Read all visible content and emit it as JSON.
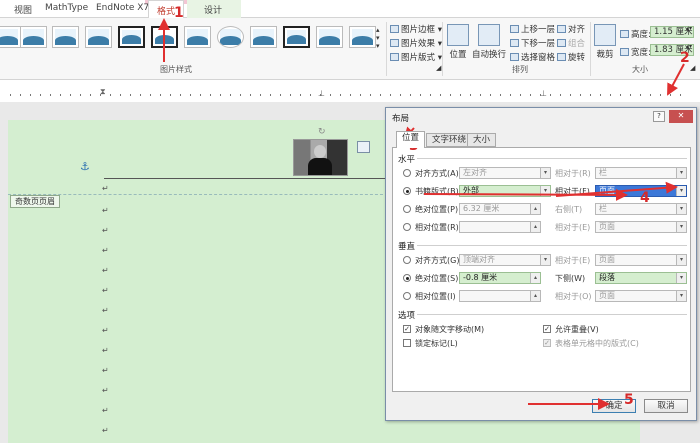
{
  "tabs": [
    "视图",
    "MathType",
    "EndNote X7",
    "格式",
    "设计"
  ],
  "ribbon": {
    "styles_group": "图片样式",
    "border": "图片边框",
    "effects": "图片效果",
    "layout": "图片版式",
    "position": "位置",
    "wrap": "自动换行",
    "bring_forward": "上移一层",
    "send_backward": "下移一层",
    "selection_pane": "选择窗格",
    "align": "对齐",
    "group": "组合",
    "rotate": "旋转",
    "arrange_group": "排列",
    "crop": "裁剪",
    "height_label": "高度:",
    "height_value": "1.15 厘米",
    "width_label": "宽度:",
    "width_value": "1.83 厘米",
    "size_group": "大小"
  },
  "document": {
    "header_tag": "奇数页页眉",
    "para_mark": "↵"
  },
  "dialog": {
    "title": "布局",
    "help": "?",
    "close": "✕",
    "tabs": [
      "位置",
      "文字环绕",
      "大小"
    ],
    "horizontal": {
      "title": "水平",
      "align_label": "对齐方式(A)",
      "align_value": "左对齐",
      "align_rel_label": "相对于(R)",
      "align_rel_value": "栏",
      "book_label": "书籍版式(B)",
      "book_value": "外部",
      "book_rel_label": "相对于(F)",
      "book_rel_value": "页面",
      "abs_label": "绝对位置(P)",
      "abs_value": "6.32 厘米",
      "abs_rel_label": "右侧(T)",
      "abs_rel_value": "栏",
      "rel_label": "相对位置(R)",
      "rel_rel_label": "相对于(E)",
      "rel_rel_value": "页面"
    },
    "vertical": {
      "title": "垂直",
      "align_label": "对齐方式(G)",
      "align_value": "顶端对齐",
      "align_rel_label": "相对于(E)",
      "align_rel_value": "页面",
      "abs_label": "绝对位置(S)",
      "abs_value": "-0.8 厘米",
      "abs_rel_label": "下侧(W)",
      "abs_rel_value": "段落",
      "rel_label": "相对位置(I)",
      "rel_rel_label": "相对于(O)",
      "rel_rel_value": "页面"
    },
    "options": {
      "title": "选项",
      "move_with_text": "对象随文字移动(M)",
      "allow_overlap": "允许重叠(V)",
      "lock_anchor": "锁定标记(L)",
      "layout_in_cell": "表格单元格中的版式(C)"
    },
    "ok": "确定",
    "cancel": "取消"
  },
  "annotations": [
    "1",
    "2",
    "3",
    "4",
    "5"
  ]
}
